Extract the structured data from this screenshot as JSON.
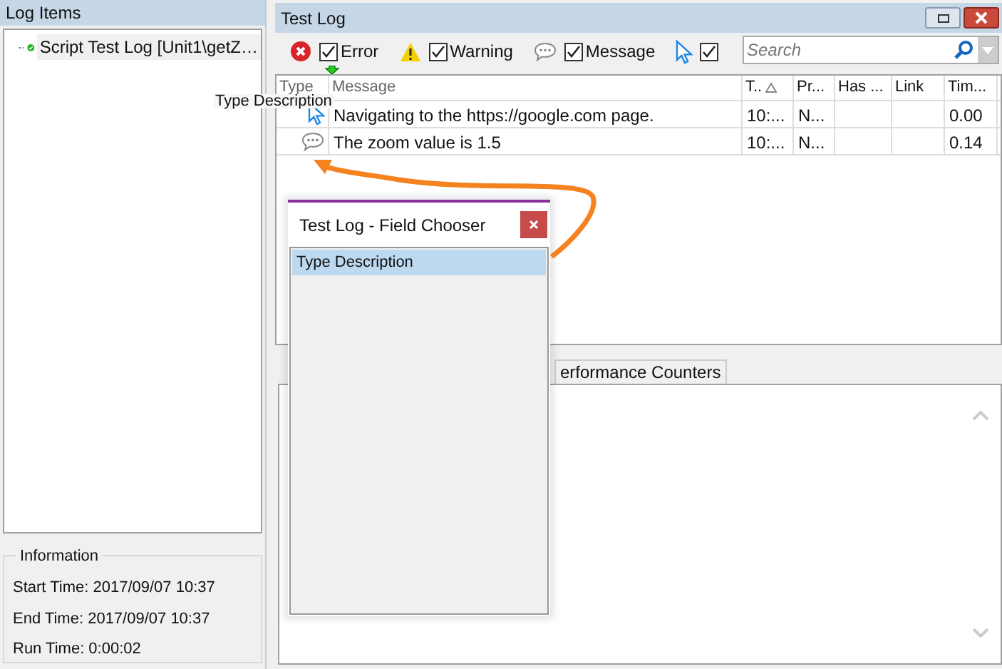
{
  "log_items": {
    "title": "Log Items",
    "items": [
      {
        "label": "Script Test Log [Unit1\\getZ…",
        "passed": true
      }
    ]
  },
  "information": {
    "title": "Information",
    "lines": [
      "Start Time: 2017/09/07 10:37",
      "End Time: 2017/09/07 10:37",
      "Run Time: 0:00:02"
    ]
  },
  "test_log": {
    "title": "Test Log",
    "filters": [
      {
        "kind": "error",
        "label": "Error",
        "checked": true
      },
      {
        "kind": "warning",
        "label": "Warning",
        "checked": true
      },
      {
        "kind": "message",
        "label": "Message",
        "checked": true
      },
      {
        "kind": "event",
        "checked": true
      }
    ],
    "search": {
      "placeholder": "Search"
    },
    "columns": [
      "Type",
      "Message",
      "T..",
      "Pr...",
      "Has ...",
      "Link",
      "Tim..."
    ],
    "rows": [
      {
        "kind": "event",
        "cells": [
          "",
          "Navigating to the https://google.com page.",
          "10:...",
          "N...",
          "",
          "",
          "0.00"
        ]
      },
      {
        "kind": "message",
        "cells": [
          "",
          "The zoom value is 1.5",
          "10:...",
          "N...",
          "",
          "",
          "0.14"
        ]
      }
    ],
    "drag_label": "Type Description",
    "tabs": [
      {
        "label": "erformance Counters",
        "selected": false
      }
    ]
  },
  "field_chooser": {
    "title": "Test Log - Field Chooser",
    "items": [
      {
        "label": "Type Description",
        "selected": true
      }
    ]
  }
}
